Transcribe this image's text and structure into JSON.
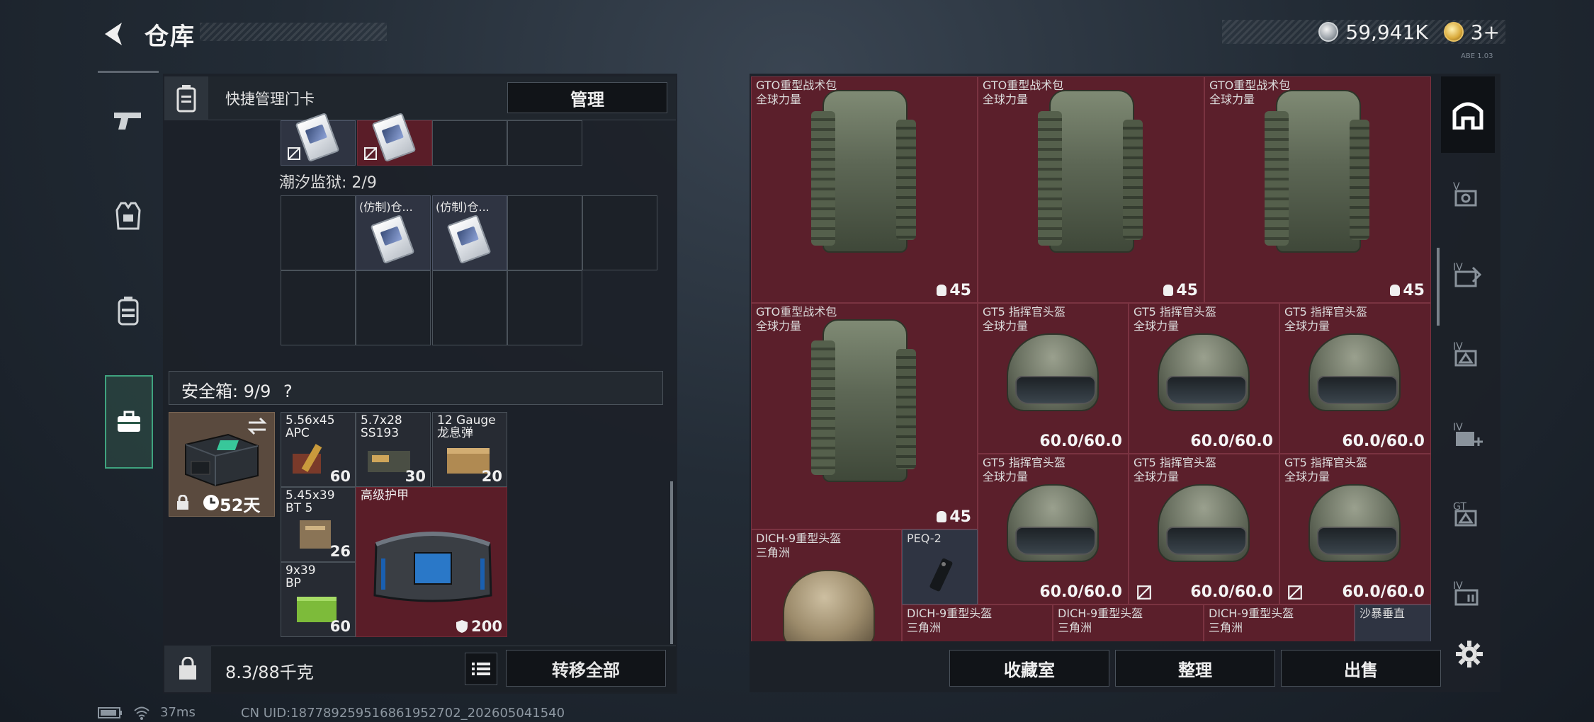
{
  "header": {
    "title": "仓库",
    "currency_amount": "59,941K",
    "tickets": "3+",
    "version_hint": "ABE 1.03"
  },
  "left_tabs": [
    {
      "name": "weapons",
      "icon": "pistol-icon"
    },
    {
      "name": "vest",
      "icon": "vest-icon"
    },
    {
      "name": "backpack",
      "icon": "backpack-icon"
    },
    {
      "name": "safe",
      "icon": "briefcase-icon",
      "active": true
    }
  ],
  "card_panel": {
    "title": "快捷管理门卡",
    "manage_label": "管理",
    "prison_label": "潮汐监狱: 2/9",
    "card_label_1": "(仿制)仓...",
    "card_label_2": "(仿制)仓..."
  },
  "safe": {
    "header_label": "安全箱: 9/9",
    "help_label": "?",
    "days": "52天"
  },
  "safe_items": [
    {
      "name_line1": "5.56x45",
      "name_line2": "APC",
      "count": "60"
    },
    {
      "name_line1": "5.7x28",
      "name_line2": "SS193",
      "count": "30"
    },
    {
      "name_line1": "12 Gauge",
      "name_line2": "龙息弹",
      "count": "20"
    },
    {
      "name_line1": "5.45x39",
      "name_line2": "BT 5",
      "count": "26"
    },
    {
      "name_line1": "高级护甲",
      "name_line2": "",
      "count": "200"
    },
    {
      "name_line1": "9x39",
      "name_line2": "BP",
      "count": "60"
    }
  ],
  "bottom": {
    "weight": "8.3/88千克",
    "transfer_all": "转移全部"
  },
  "stash": {
    "backpack_name": "GTO重型战术包",
    "backpack_sub": "全球力量",
    "backpack_qty": "45",
    "helmet_name": "GT5 指挥官头盔",
    "helmet_sub": "全球力量",
    "helmet_dur": "60.0/60.0",
    "dich_name": "DICH-9重型头盔",
    "dich_sub": "三角洲",
    "peq_name": "PEQ-2",
    "sand_name": "沙暴垂直"
  },
  "right_actions": {
    "collection": "收藏室",
    "sort": "整理",
    "sell": "出售"
  },
  "status": {
    "ping": "37ms",
    "uid": "CN UID:18778925951686195270​2_202605041540"
  },
  "colors": {
    "accent_green": "#3fa37f",
    "item_red": "#5b1f2b",
    "panel_bg": "#1c2128"
  }
}
